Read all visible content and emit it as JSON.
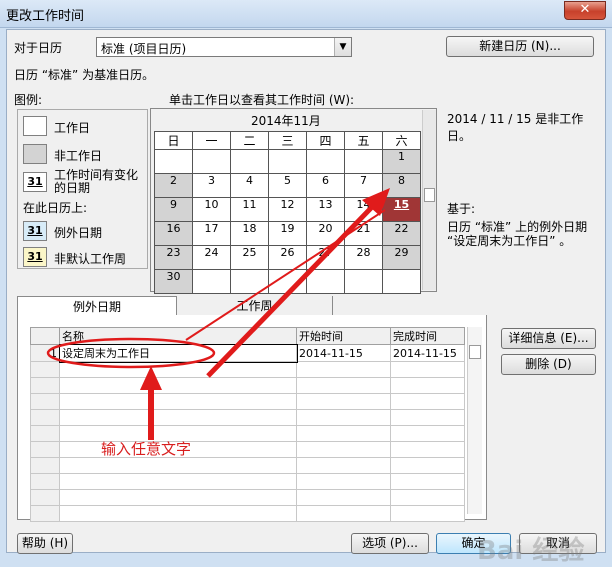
{
  "window": {
    "title": "更改工作时间",
    "close_symbol": "✕"
  },
  "calendar_for": {
    "label": "对于日历",
    "value": "标准 (项目日历)",
    "new_calendar_button": "新建日历 (N)..."
  },
  "base_info": "日历 “标准” 为基准日历。",
  "legend": {
    "title": "图例:",
    "items": [
      {
        "label": "工作日"
      },
      {
        "label": "非工作日"
      },
      {
        "badge": "31",
        "label": "工作时间有变化的日期"
      }
    ],
    "on_this_calendar": "在此日历上:",
    "calendar_items": [
      {
        "badge": "31",
        "label": "例外日期"
      },
      {
        "badge": "31",
        "label": "非默认工作周"
      }
    ]
  },
  "calendar": {
    "instruction": "单击工作日以查看其工作时间 (W):",
    "month": "2014年11月",
    "weekdays": [
      "日",
      "一",
      "二",
      "三",
      "四",
      "五",
      "六"
    ],
    "weeks": [
      [
        "",
        "",
        "",
        "",
        "",
        "",
        "1"
      ],
      [
        "2",
        "3",
        "4",
        "5",
        "6",
        "7",
        "8"
      ],
      [
        "9",
        "10",
        "11",
        "12",
        "13",
        "14",
        "15"
      ],
      [
        "16",
        "17",
        "18",
        "19",
        "20",
        "21",
        "22"
      ],
      [
        "23",
        "24",
        "25",
        "26",
        "27",
        "28",
        "29"
      ],
      [
        "30",
        "",
        "",
        "",
        "",
        "",
        ""
      ]
    ]
  },
  "info": {
    "status": "2014 / 11 / 15 是非工作日。",
    "based_on_label": "基于:",
    "based_on_text": "日历 “标准” 上的例外日期 “设定周末为工作日” 。"
  },
  "tabs": [
    "例外日期",
    "工作周"
  ],
  "grid": {
    "headers": [
      "名称",
      "开始时间",
      "完成时间"
    ],
    "rows": [
      {
        "num": "1",
        "name": "设定周末为工作日",
        "start": "2014-11-15",
        "end": "2014-11-15"
      }
    ]
  },
  "side_buttons": {
    "details": "详细信息 (E)...",
    "delete": "删除 (D)"
  },
  "annotation": "输入任意文字",
  "footer": {
    "help": "帮助 (H)",
    "options": "选项 (P)...",
    "ok": "确定",
    "cancel": "取消"
  },
  "watermark": "Bai 经验",
  "colors": {
    "annotation_red": "#e01b1b",
    "exception_day": "#a03636",
    "non_working": "#d3d3d3"
  }
}
